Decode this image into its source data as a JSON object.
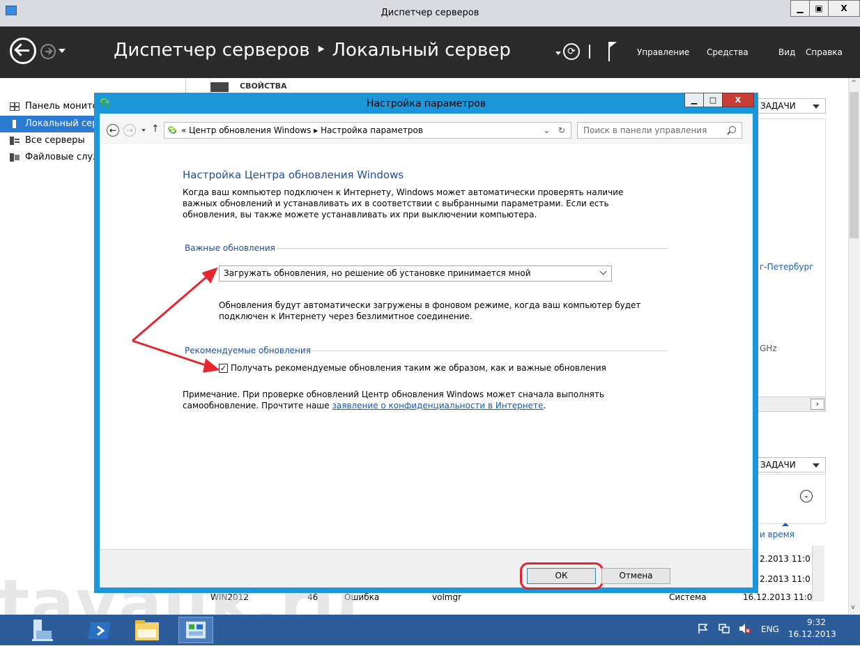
{
  "outer": {
    "title": "Диспетчер серверов",
    "breadcrumb": "Диспетчер серверов ‣ Локальный сервер",
    "menu": [
      "Управление",
      "Средства",
      "Вид",
      "Справка"
    ],
    "window_buttons": {
      "minimize": "▁",
      "maximize": "▣",
      "close": "X"
    }
  },
  "sidebar": {
    "items": [
      {
        "label": "Панель мониторинга",
        "active": false
      },
      {
        "label": "Локальный сервер",
        "active": true
      },
      {
        "label": "Все серверы",
        "active": false
      },
      {
        "label": "Файловые службы",
        "active": false
      }
    ]
  },
  "background": {
    "properties_label": "СВОЙСТВА",
    "tasks_label": "ЗАДАЧИ",
    "city": "г-Петербург",
    "cpu": "GHz",
    "date_time_col": "и время",
    "timestamps": [
      "2.2013 11:0",
      "2.2013 11:0",
      "16.12.2013 11:0"
    ],
    "row": {
      "server": "WIN2012",
      "id": "46",
      "severity": "Ошибка",
      "source": "volmgr",
      "log": "Система"
    }
  },
  "dialog": {
    "title": "Настройка параметров",
    "address_prefix": "«",
    "address_parts": [
      "Центр обновления Windows",
      "▸",
      "Настройка параметров"
    ],
    "search_placeholder": "Поиск в панели управления",
    "heading": "Настройка Центра обновления Windows",
    "intro_lines": [
      "Когда ваш компьютер подключен к Интернету, Windows может автоматически проверять наличие",
      "важных обновлений и устанавливать их в соответствии с выбранными параметрами. Если есть",
      "обновления, вы также можете устанавливать их при выключении компьютера."
    ],
    "important_section": "Важные обновления",
    "important_option": "Загружать обновления, но решение об установке принимается мной",
    "important_desc_lines": [
      "Обновления будут автоматически загружены в фоновом режиме, когда ваш компьютер будет",
      "подключен к Интернету через безлимитное соединение."
    ],
    "recommended_section": "Рекомендуемые обновления",
    "recommended_checkbox": "Получать рекомендуемые обновления таким же образом, как и важные обновления",
    "recommended_checked": true,
    "note_line1": "Примечание. При проверке обновлений Центр обновления Windows может сначала выполнять",
    "note_line2_prefix": "самообновление. Прочтите наше ",
    "note_link": "заявление о конфиденциальности в Интернете",
    "note_line2_suffix": ".",
    "ok_label": "ОК",
    "cancel_label": "Отмена"
  },
  "taskbar": {
    "language": "ENG",
    "time": "9:32",
    "date": "16.12.2013"
  },
  "watermark": "tavalik.ru",
  "colors": {
    "accent": "#1b96d8",
    "header": "#2b2b2b",
    "annotation": "#e8252c",
    "link": "#0b5bc4"
  }
}
